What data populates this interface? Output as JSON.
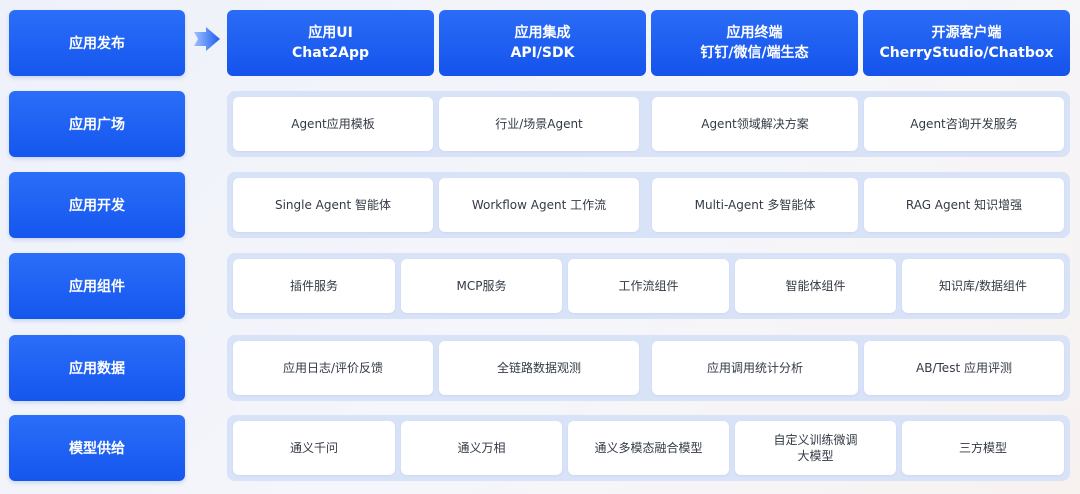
{
  "rows": [
    {
      "label": "应用发布"
    },
    {
      "label": "应用广场"
    },
    {
      "label": "应用开发"
    },
    {
      "label": "应用组件"
    },
    {
      "label": "应用数据"
    },
    {
      "label": "模型供给"
    }
  ],
  "release": {
    "cards": [
      {
        "line1": "应用UI",
        "line2": "Chat2App"
      },
      {
        "line1": "应用集成",
        "line2": "API/SDK"
      },
      {
        "line1": "应用终端",
        "line2": "钉钉/微信/端生态"
      },
      {
        "line1": "开源客户端",
        "line2": "CherryStudio/Chatbox"
      }
    ]
  },
  "plaza": {
    "items": [
      "Agent应用模板",
      "行业/场景Agent",
      "Agent领域解决方案",
      "Agent咨询开发服务"
    ]
  },
  "dev": {
    "items": [
      "Single Agent 智能体",
      "Workflow Agent 工作流",
      "Multi-Agent 多智能体",
      "RAG Agent 知识增强"
    ]
  },
  "components": {
    "items": [
      "插件服务",
      "MCP服务",
      "工作流组件",
      "智能体组件",
      "知识库/数据组件"
    ]
  },
  "data": {
    "items": [
      "应用日志/评价反馈",
      "全链路数据观测",
      "应用调用统计分析",
      "AB/Test 应用评测"
    ]
  },
  "models": {
    "items": [
      "通义千问",
      "通义万相",
      "通义多模态融合模型",
      "自定义训练微调",
      "大模型",
      "三方模型"
    ]
  }
}
